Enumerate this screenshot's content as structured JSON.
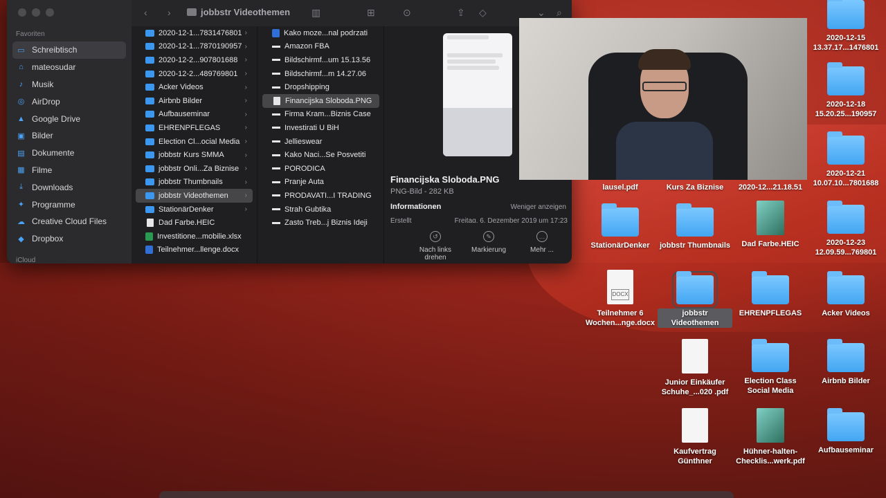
{
  "finder": {
    "title": "jobbstr Videothemen",
    "sidebar": {
      "favorites_label": "Favoriten",
      "icloud_label": "iCloud",
      "items": [
        {
          "label": "Schreibtisch",
          "icon": "desktop-icon",
          "selected": true
        },
        {
          "label": "mateosudar",
          "icon": "home-icon"
        },
        {
          "label": "Musik",
          "icon": "music-icon"
        },
        {
          "label": "AirDrop",
          "icon": "airdrop-icon"
        },
        {
          "label": "Google Drive",
          "icon": "drive-icon"
        },
        {
          "label": "Bilder",
          "icon": "photos-icon"
        },
        {
          "label": "Dokumente",
          "icon": "document-icon"
        },
        {
          "label": "Filme",
          "icon": "film-icon"
        },
        {
          "label": "Downloads",
          "icon": "download-icon"
        },
        {
          "label": "Programme",
          "icon": "apps-icon"
        },
        {
          "label": "Creative Cloud Files",
          "icon": "cloud-icon"
        },
        {
          "label": "Dropbox",
          "icon": "dropbox-icon"
        }
      ]
    },
    "column1": [
      {
        "label": "2020-12-1...7831476801",
        "type": "folder"
      },
      {
        "label": "2020-12-1...7870190957",
        "type": "folder"
      },
      {
        "label": "2020-12-2...907801688",
        "type": "folder"
      },
      {
        "label": "2020-12-2...489769801",
        "type": "folder"
      },
      {
        "label": "Acker Videos",
        "type": "folder"
      },
      {
        "label": "Airbnb Bilder",
        "type": "folder"
      },
      {
        "label": "Aufbauseminar",
        "type": "folder"
      },
      {
        "label": "EHRENPFLEGAS",
        "type": "folder"
      },
      {
        "label": "Election Cl...ocial Media",
        "type": "folder"
      },
      {
        "label": "jobbstr Kurs SMMA",
        "type": "folder"
      },
      {
        "label": "jobbstr Onli...Za Biznise",
        "type": "folder"
      },
      {
        "label": "jobbstr Thumbnails",
        "type": "folder"
      },
      {
        "label": "jobbstr Videothemen",
        "type": "folder",
        "selected": true
      },
      {
        "label": "StationärDenker",
        "type": "folder"
      },
      {
        "label": "Dad Farbe.HEIC",
        "type": "file"
      },
      {
        "label": "Investitione...mobilie.xlsx",
        "type": "xls"
      },
      {
        "label": "Teilnehmer...llenge.docx",
        "type": "word"
      }
    ],
    "column2": [
      {
        "label": "Kako moze...nal podrzati",
        "type": "word"
      },
      {
        "label": "Amazon FBA",
        "type": "dash"
      },
      {
        "label": "Bildschirmf...um 15.13.56",
        "type": "dash"
      },
      {
        "label": "Bildschirmf...m 14.27.06",
        "type": "dash"
      },
      {
        "label": "Dropshipping",
        "type": "dash"
      },
      {
        "label": "Financijska Sloboda.PNG",
        "type": "file",
        "selected": true
      },
      {
        "label": "Firma Kram...Biznis Case",
        "type": "dash"
      },
      {
        "label": "Investirati U BiH",
        "type": "dash"
      },
      {
        "label": "Jellieswear",
        "type": "dash"
      },
      {
        "label": "Kako Naci...Se Posvetiti",
        "type": "dash"
      },
      {
        "label": "PORODICA",
        "type": "dash"
      },
      {
        "label": "Pranje Auta",
        "type": "dash"
      },
      {
        "label": "PRODAVATI...I TRADING",
        "type": "dash"
      },
      {
        "label": "Strah Gubtika",
        "type": "dash"
      },
      {
        "label": "Zasto Treb...j Biznis Ideji",
        "type": "dash"
      }
    ],
    "preview": {
      "name": "Financijska Sloboda.PNG",
      "kind": "PNG-Bild - 282 KB",
      "info_label": "Informationen",
      "less_label": "Weniger anzeigen",
      "created_label": "Erstellt",
      "created_value": "Freitag, 6. Dezember 2019 um 17:23",
      "actions": [
        {
          "label": "Nach links drehen",
          "icon": "rotate-left-icon"
        },
        {
          "label": "Markierung",
          "icon": "markup-icon"
        },
        {
          "label": "Mehr ...",
          "icon": "more-icon"
        }
      ]
    }
  },
  "desktop": {
    "icons": [
      {
        "label": "2020-12-15 13.37.17...1476801",
        "kind": "folder"
      },
      {
        "label": "2020-12-18 15.20.25...190957",
        "kind": "folder"
      },
      {
        "label": "2020-12-21 10.07.10...7801688",
        "kind": "folder"
      },
      {
        "label": "lausel.pdf",
        "kind": "none"
      },
      {
        "label": "Kurs Za Biznise",
        "kind": "none"
      },
      {
        "label": "2020-12...21.18.51",
        "kind": "none"
      },
      {
        "label": "StationärDenker",
        "kind": "folder"
      },
      {
        "label": "jobbstr Thumbnails",
        "kind": "folder"
      },
      {
        "label": "Dad Farbe.HEIC",
        "kind": "image"
      },
      {
        "label": "2020-12-23 12.09.59...769801",
        "kind": "folder"
      },
      {
        "label": "Teilnehmer 6 Wochen...nge.docx",
        "kind": "docx"
      },
      {
        "label": "jobbstr Videothemen",
        "kind": "folder",
        "selected": true
      },
      {
        "label": "EHRENPFLEGAS",
        "kind": "folder"
      },
      {
        "label": "Acker Videos",
        "kind": "folder"
      },
      {
        "label": "Junior Einkäufer Schuhe_...020 .pdf",
        "kind": "pdf"
      },
      {
        "label": "Election Class Social Media",
        "kind": "folder"
      },
      {
        "label": "Airbnb Bilder",
        "kind": "folder"
      },
      {
        "label": "Kaufvertrag Günthner",
        "kind": "pdf"
      },
      {
        "label": "Hühner-halten-Checklis...werk.pdf",
        "kind": "image"
      },
      {
        "label": "Aufbauseminar",
        "kind": "folder"
      }
    ],
    "docx_badge": "DOCX"
  }
}
